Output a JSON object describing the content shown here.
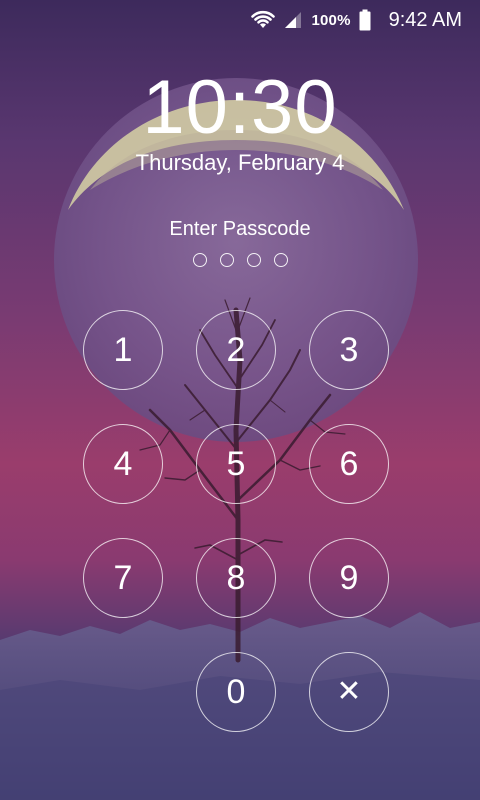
{
  "status_bar": {
    "wifi_icon": "wifi-icon",
    "signal_icon": "signal-icon",
    "battery_percent": "100%",
    "battery_icon": "battery-icon",
    "time": "9:42 AM"
  },
  "lockscreen": {
    "clock": "10:30",
    "date": "Thursday, February 4",
    "prompt": "Enter Passcode",
    "passcode_slots": 4
  },
  "keypad": {
    "keys": [
      "1",
      "2",
      "3",
      "4",
      "5",
      "6",
      "7",
      "8",
      "9",
      "0"
    ],
    "delete_icon": "close-icon",
    "delete_symbol": "✕"
  }
}
